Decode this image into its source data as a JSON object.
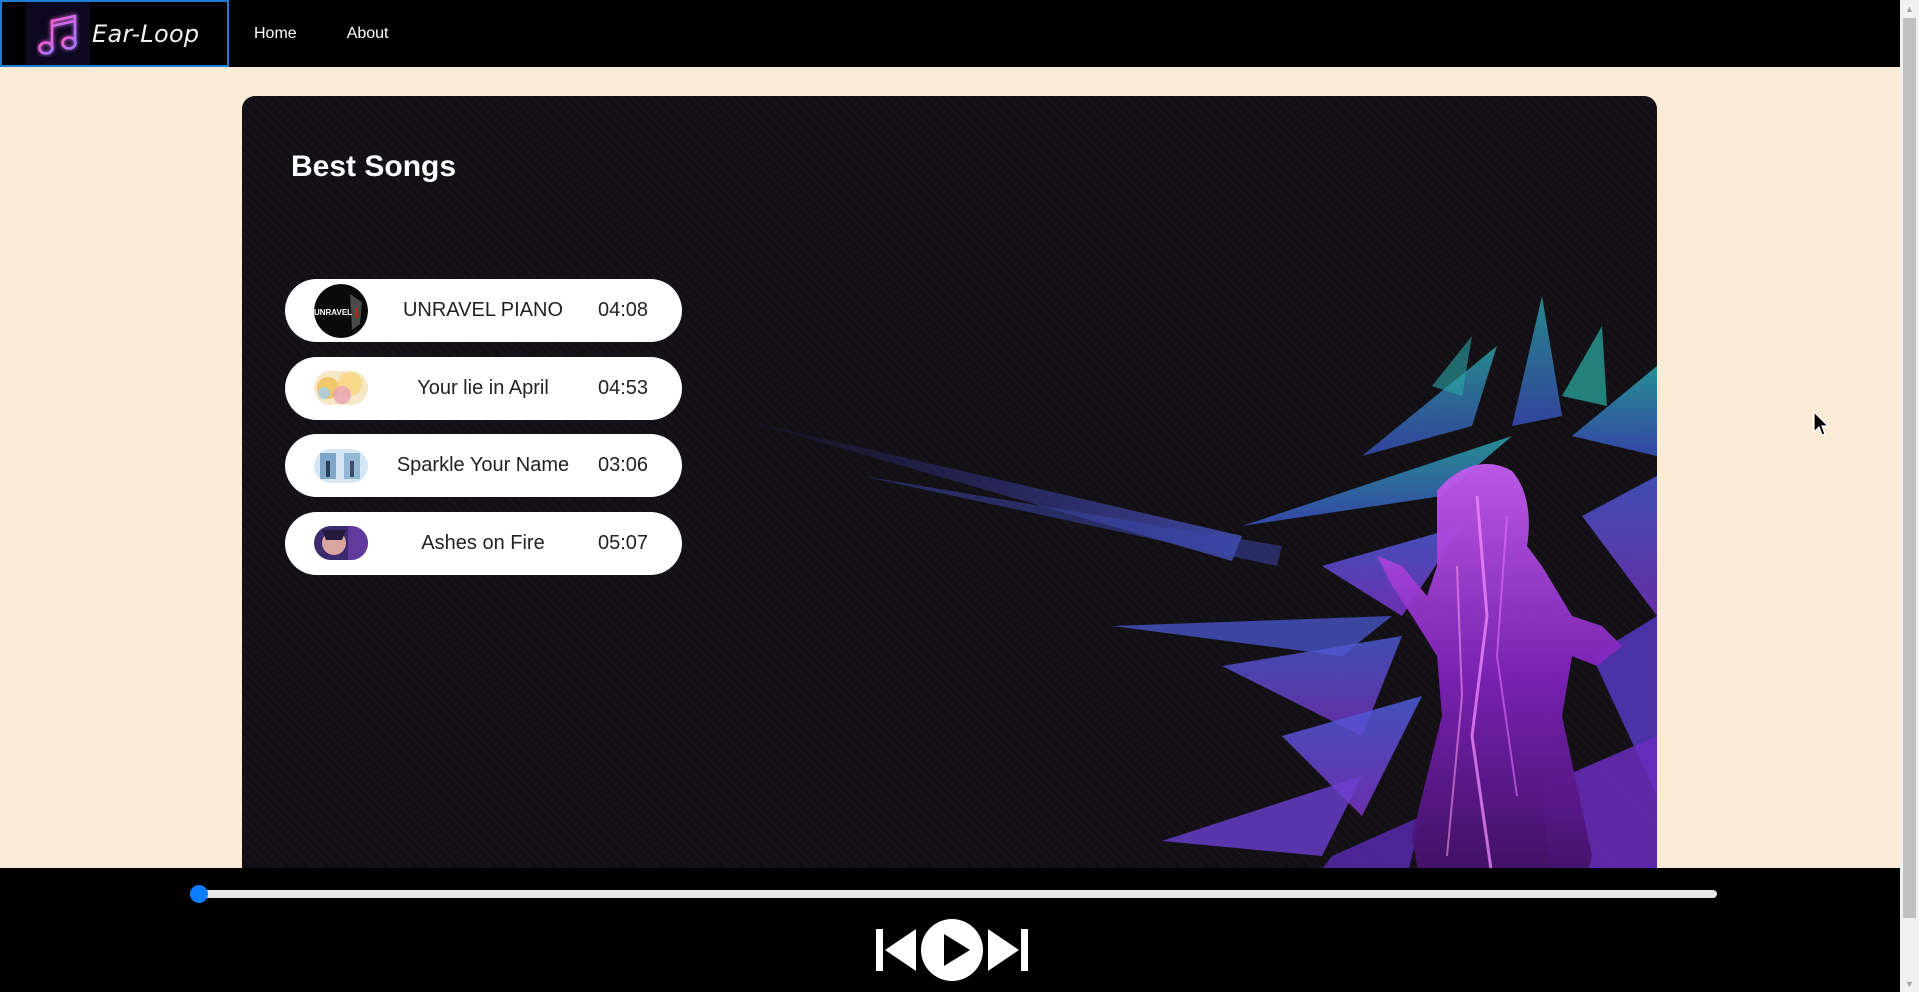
{
  "brand": {
    "name": "Ear-Loop",
    "logo_icon": "music-note-icon"
  },
  "nav": {
    "items": [
      {
        "label": "Home"
      },
      {
        "label": "About"
      }
    ]
  },
  "main": {
    "title": "Best Songs",
    "songs": [
      {
        "title": "UNRAVEL PIANO",
        "duration": "04:08",
        "thumb_label": "UNRAVEL"
      },
      {
        "title": "Your lie in April",
        "duration": "04:53"
      },
      {
        "title": "Sparkle Your Name",
        "duration": "03:06"
      },
      {
        "title": "Ashes on Fire",
        "duration": "05:07"
      }
    ]
  },
  "player": {
    "progress": 0,
    "controls": {
      "previous_icon": "skip-back-icon",
      "play_icon": "play-icon",
      "next_icon": "skip-forward-icon"
    }
  },
  "colors": {
    "page_bg": "#faebd7",
    "navbar_bg": "#000000",
    "accent": "#0a7cff",
    "card_bg": "#121015",
    "brand_border": "#1e7bd6"
  }
}
